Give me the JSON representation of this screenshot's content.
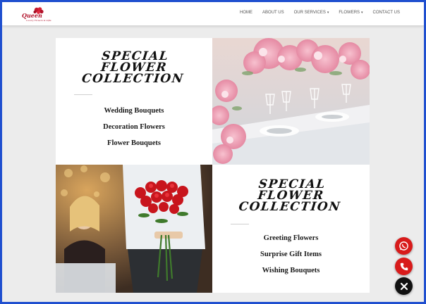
{
  "brand": {
    "logo_text": "Queen",
    "logo_sub": "Luxury Flowers & Gifts"
  },
  "nav": {
    "items": [
      {
        "label": "HOME",
        "dropdown": false
      },
      {
        "label": "ABOUT US",
        "dropdown": false
      },
      {
        "label": "OUR SERVICES",
        "dropdown": true
      },
      {
        "label": "FLOWERS",
        "dropdown": true
      },
      {
        "label": "CONTACT US",
        "dropdown": false
      }
    ]
  },
  "section1": {
    "heading": [
      "SPECIAL",
      "FLOWER",
      "COLLECTION"
    ],
    "items": [
      "Wedding Bouquets",
      "Decoration Flowers",
      "Flower Bouquets"
    ]
  },
  "section2": {
    "heading": [
      "SPECIAL",
      "FLOWER",
      "COLLECTION"
    ],
    "items": [
      "Greeting Flowers",
      "Surprise Gift Items",
      "Wishing Bouquets"
    ]
  },
  "floating": {
    "whatsapp_color": "#d81b1b",
    "phone_color": "#d81b1b",
    "close_color": "#111111"
  },
  "colors": {
    "frame": "#1f4fcf",
    "accent_red": "#d81b1b"
  }
}
